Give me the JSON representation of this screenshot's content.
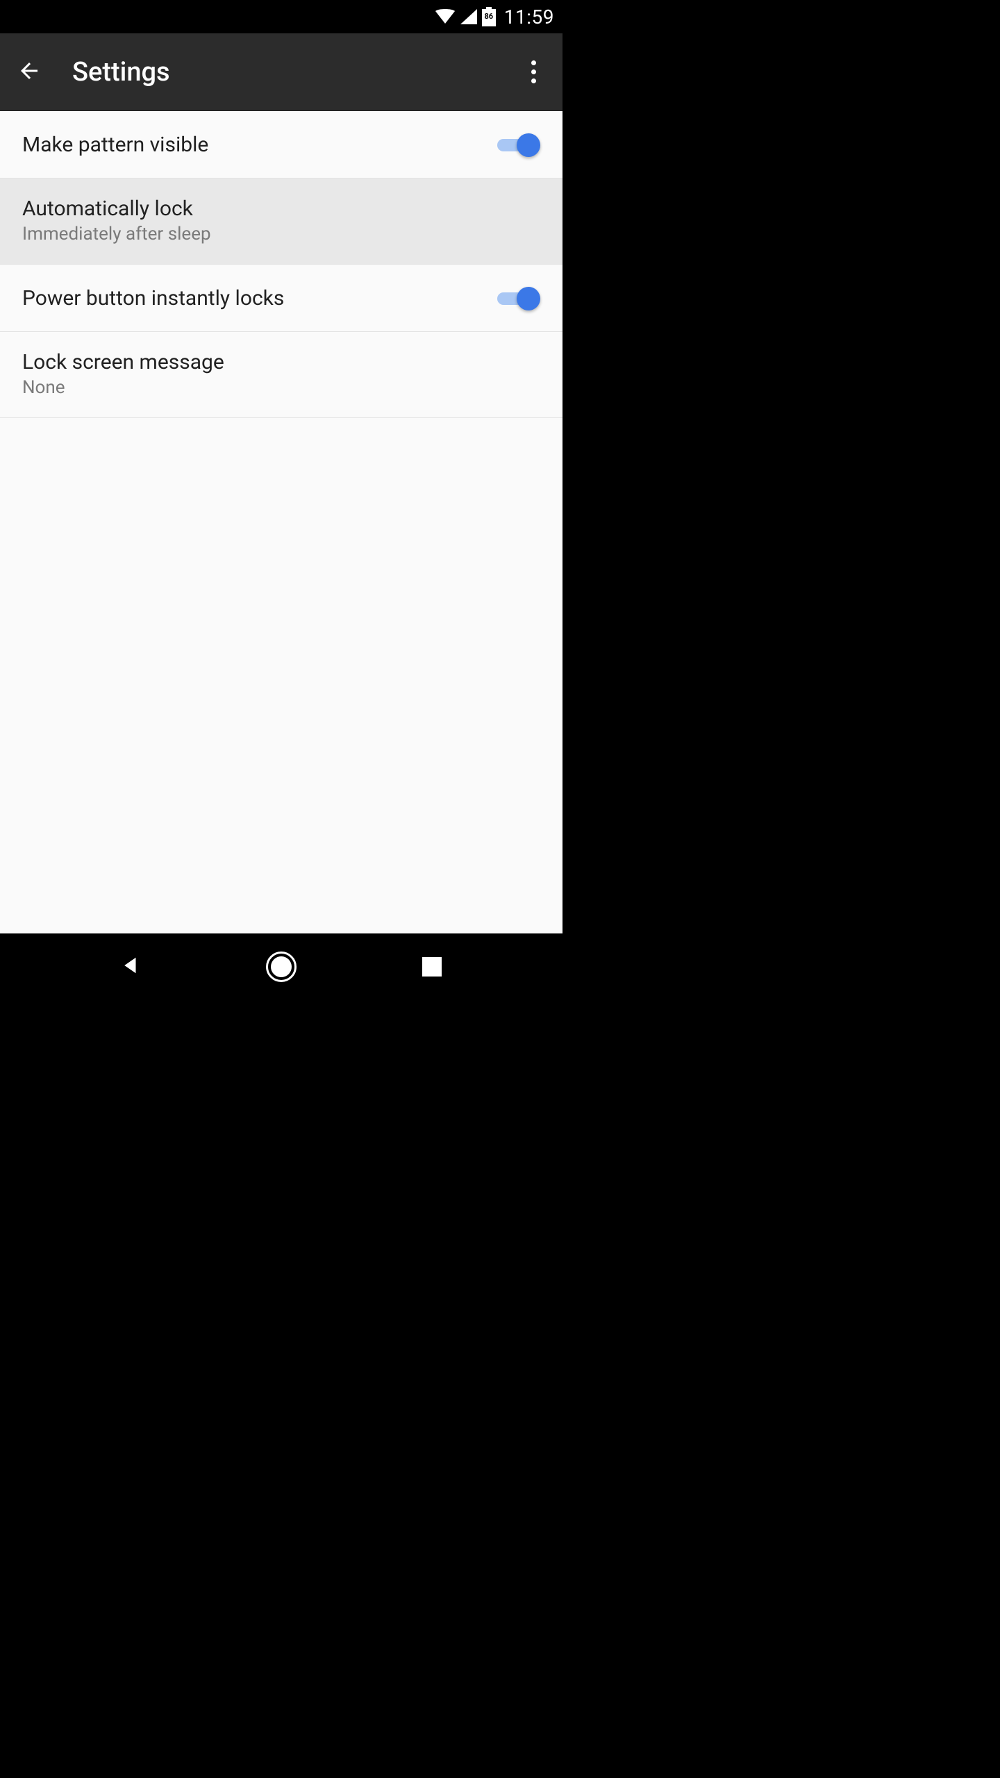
{
  "status": {
    "battery_pct": "86",
    "time": "11:59"
  },
  "header": {
    "title": "Settings"
  },
  "settings": {
    "pattern_visible": {
      "label": "Make pattern visible",
      "on": true
    },
    "auto_lock": {
      "label": "Automatically lock",
      "value": "Immediately after sleep"
    },
    "power_lock": {
      "label": "Power button instantly locks",
      "on": true
    },
    "lock_msg": {
      "label": "Lock screen message",
      "value": "None"
    }
  }
}
